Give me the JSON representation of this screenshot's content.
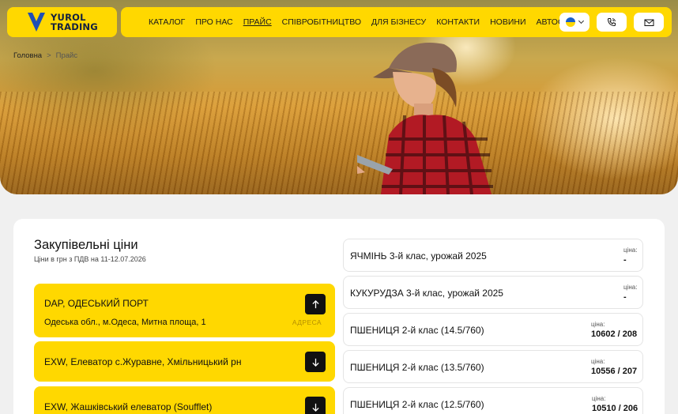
{
  "header": {
    "logo": {
      "line1": "YUROL",
      "line2": "TRADING"
    },
    "nav": [
      {
        "label": "КАТАЛОГ",
        "active": false
      },
      {
        "label": "ПРО НАС",
        "active": false
      },
      {
        "label": "ПРАЙС",
        "active": true
      },
      {
        "label": "СПІВРОБІТНИЦТВО",
        "active": false
      },
      {
        "label": "ДЛЯ БІЗНЕСУ",
        "active": false
      },
      {
        "label": "КОНТАКТИ",
        "active": false
      },
      {
        "label": "НОВИНИ",
        "active": false
      },
      {
        "label": "АВТОСЕРВІС",
        "active": false
      }
    ],
    "language_icon": "ukraine-flag-icon",
    "phone_icon": "phone-icon",
    "mail_icon": "mail-icon"
  },
  "breadcrumb": {
    "home": "Головна",
    "separator": ">",
    "current": "Прайс"
  },
  "main": {
    "title": "Закупівельні ціни",
    "subtitle": "Ціни в грн з ПДВ на 11-12.07.2026",
    "locations": [
      {
        "name": "DAP, ОДЕСЬКИЙ ПОРТ",
        "address": "Одеська обл., м.Одеса, Митна площа, 1",
        "address_label": "АДРЕСА",
        "expanded": true
      },
      {
        "name": "EXW, Елеватор с.Журавне, Хмільницький рн",
        "expanded": false
      },
      {
        "name": "EXW, Жашківський елеватор (Soufflet)",
        "expanded": false
      }
    ],
    "prices": [
      {
        "name": "ЯЧМІНЬ 3-й клас, урожай 2025",
        "label": "ціна:",
        "value": "-"
      },
      {
        "name": "КУКУРУДЗА 3-й клас, урожай 2025",
        "label": "ціна:",
        "value": "-"
      },
      {
        "name": "ПШЕНИЦЯ 2-й клас (14.5/760)",
        "label": "ціна:",
        "value": "10602 / 208"
      },
      {
        "name": "ПШЕНИЦЯ 2-й клас (13.5/760)",
        "label": "ціна:",
        "value": "10556 / 207"
      },
      {
        "name": "ПШЕНИЦЯ 2-й клас (12.5/760)",
        "label": "ціна:",
        "value": "10510 / 206"
      }
    ]
  },
  "colors": {
    "accent": "#ffd800",
    "background": "#f0f0f0",
    "dark": "#111111",
    "logo_blue": "#13213f"
  }
}
